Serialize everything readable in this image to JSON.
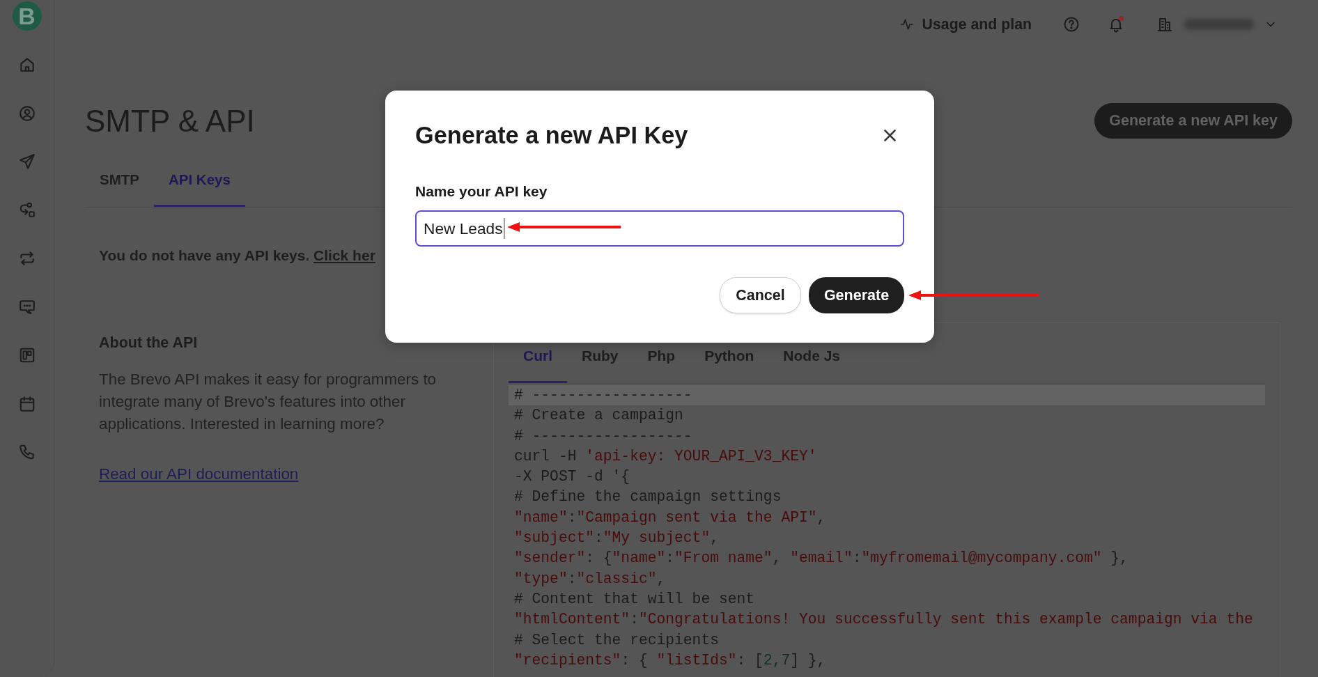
{
  "sidebar": {
    "logo": "B"
  },
  "top_bar": {
    "usage_link": "Usage and plan",
    "notifications": {
      "unread": true
    }
  },
  "page": {
    "title": "SMTP & API",
    "primary_button": "Generate a new API key",
    "tabs": [
      {
        "label": "SMTP",
        "selected": false
      },
      {
        "label": "API Keys",
        "selected": true
      }
    ],
    "empty_state": {
      "text": "You do not have any API keys.",
      "link": "Click her"
    },
    "about": {
      "heading": "About the API",
      "text": "The Brevo API makes it easy for programmers to integrate many of Brevo's features into other applications. Interested in learning more?",
      "link": "Read our API documentation"
    },
    "code_sample": {
      "tabs": [
        {
          "label": "Curl",
          "selected": true
        },
        {
          "label": "Ruby",
          "selected": false
        },
        {
          "label": "Php",
          "selected": false
        },
        {
          "label": "Python",
          "selected": false
        },
        {
          "label": "Node Js",
          "selected": false
        }
      ],
      "lines": [
        {
          "highlighted": true,
          "segments": [
            {
              "kind": "plain",
              "text": "# ------------------"
            }
          ]
        },
        {
          "highlighted": false,
          "segments": [
            {
              "kind": "plain",
              "text": "# Create a campaign"
            }
          ]
        },
        {
          "highlighted": false,
          "segments": [
            {
              "kind": "plain",
              "text": "# ------------------"
            }
          ]
        },
        {
          "highlighted": false,
          "segments": [
            {
              "kind": "plain",
              "text": "curl -H "
            },
            {
              "kind": "string",
              "text": "'api-key: YOUR_API_V3_KEY'"
            }
          ]
        },
        {
          "highlighted": false,
          "segments": [
            {
              "kind": "plain",
              "text": "-X POST -d '{"
            }
          ]
        },
        {
          "highlighted": false,
          "segments": [
            {
              "kind": "plain",
              "text": "# Define the campaign settings"
            }
          ]
        },
        {
          "highlighted": false,
          "segments": [
            {
              "kind": "string",
              "text": "\"name\""
            },
            {
              "kind": "plain",
              "text": ":"
            },
            {
              "kind": "string",
              "text": "\"Campaign sent via the API\""
            },
            {
              "kind": "plain",
              "text": ","
            }
          ]
        },
        {
          "highlighted": false,
          "segments": [
            {
              "kind": "string",
              "text": "\"subject\""
            },
            {
              "kind": "plain",
              "text": ":"
            },
            {
              "kind": "string",
              "text": "\"My subject\""
            },
            {
              "kind": "plain",
              "text": ","
            }
          ]
        },
        {
          "highlighted": false,
          "segments": [
            {
              "kind": "string",
              "text": "\"sender\""
            },
            {
              "kind": "plain",
              "text": ": {"
            },
            {
              "kind": "string",
              "text": "\"name\""
            },
            {
              "kind": "plain",
              "text": ":"
            },
            {
              "kind": "string",
              "text": "\"From name\""
            },
            {
              "kind": "plain",
              "text": ", "
            },
            {
              "kind": "string",
              "text": "\"email\""
            },
            {
              "kind": "plain",
              "text": ":"
            },
            {
              "kind": "string",
              "text": "\"myfromemail@mycompany.com\""
            },
            {
              "kind": "plain",
              "text": " },"
            }
          ]
        },
        {
          "highlighted": false,
          "segments": [
            {
              "kind": "string",
              "text": "\"type\""
            },
            {
              "kind": "plain",
              "text": ":"
            },
            {
              "kind": "string",
              "text": "\"classic\""
            },
            {
              "kind": "plain",
              "text": ","
            }
          ]
        },
        {
          "highlighted": false,
          "segments": [
            {
              "kind": "plain",
              "text": "# Content that will be sent"
            }
          ]
        },
        {
          "highlighted": false,
          "segments": [
            {
              "kind": "string",
              "text": "\"htmlContent\""
            },
            {
              "kind": "plain",
              "text": ":"
            },
            {
              "kind": "string",
              "text": "\"Congratulations! You successfully sent this example campaign via the"
            }
          ]
        },
        {
          "highlighted": false,
          "segments": [
            {
              "kind": "plain",
              "text": "# Select the recipients"
            }
          ]
        },
        {
          "highlighted": false,
          "segments": [
            {
              "kind": "string",
              "text": "\"recipients\""
            },
            {
              "kind": "plain",
              "text": ": { "
            },
            {
              "kind": "string",
              "text": "\"listIds\""
            },
            {
              "kind": "plain",
              "text": ": ["
            },
            {
              "kind": "number",
              "text": "2,7"
            },
            {
              "kind": "plain",
              "text": "] },"
            }
          ]
        }
      ]
    }
  },
  "modal": {
    "title": "Generate a new API Key",
    "field": {
      "label": "Name your API key",
      "value": "New Leads",
      "focused": true
    },
    "buttons": [
      {
        "label": "Cancel",
        "kind": "secondary"
      },
      {
        "label": "Generate",
        "kind": "primary"
      }
    ]
  }
}
